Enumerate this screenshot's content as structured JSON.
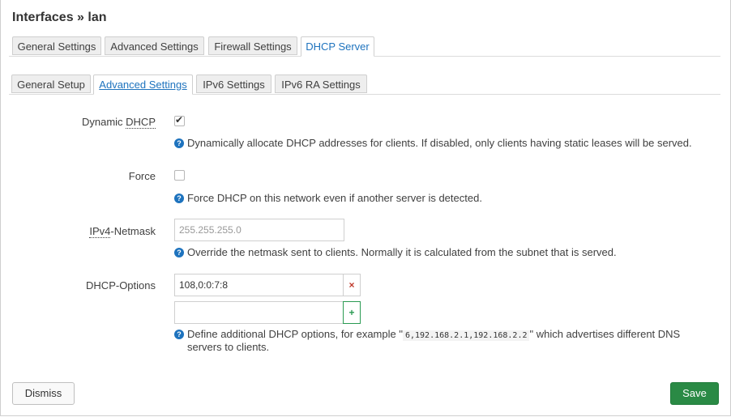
{
  "title": "Interfaces » lan",
  "main_tabs": [
    {
      "label": "General Settings"
    },
    {
      "label": "Advanced Settings"
    },
    {
      "label": "Firewall Settings"
    },
    {
      "label": "DHCP Server"
    }
  ],
  "sub_tabs": [
    {
      "label": "General Setup"
    },
    {
      "label": "Advanced Settings"
    },
    {
      "label": "IPv6 Settings"
    },
    {
      "label": "IPv6 RA Settings"
    }
  ],
  "fields": {
    "dynamic_dhcp": {
      "label_prefix": "Dynamic ",
      "label_abbr": "DHCP",
      "checked": true,
      "help": "Dynamically allocate DHCP addresses for clients. If disabled, only clients having static leases will be served."
    },
    "force": {
      "label": "Force",
      "checked": false,
      "help": "Force DHCP on this network even if another server is detected."
    },
    "netmask": {
      "label_abbr": "IPv4",
      "label_suffix": "-Netmask",
      "placeholder": "255.255.255.0",
      "help": "Override the netmask sent to clients. Normally it is calculated from the subnet that is served."
    },
    "dhcp_options": {
      "label": "DHCP-Options",
      "values": [
        "108,0:0:7:8"
      ],
      "new_value": "",
      "remove_glyph": "×",
      "add_glyph": "+",
      "help_pre": "Define additional DHCP options, for example \"",
      "help_code": "6,192.168.2.1,192.168.2.2",
      "help_post": "\" which advertises different DNS",
      "help_line2": "servers to clients."
    }
  },
  "buttons": {
    "dismiss": "Dismiss",
    "save": "Save"
  },
  "colors": {
    "accent": "#1e73be",
    "save": "#2a8a45",
    "remove": "#c0392b"
  }
}
